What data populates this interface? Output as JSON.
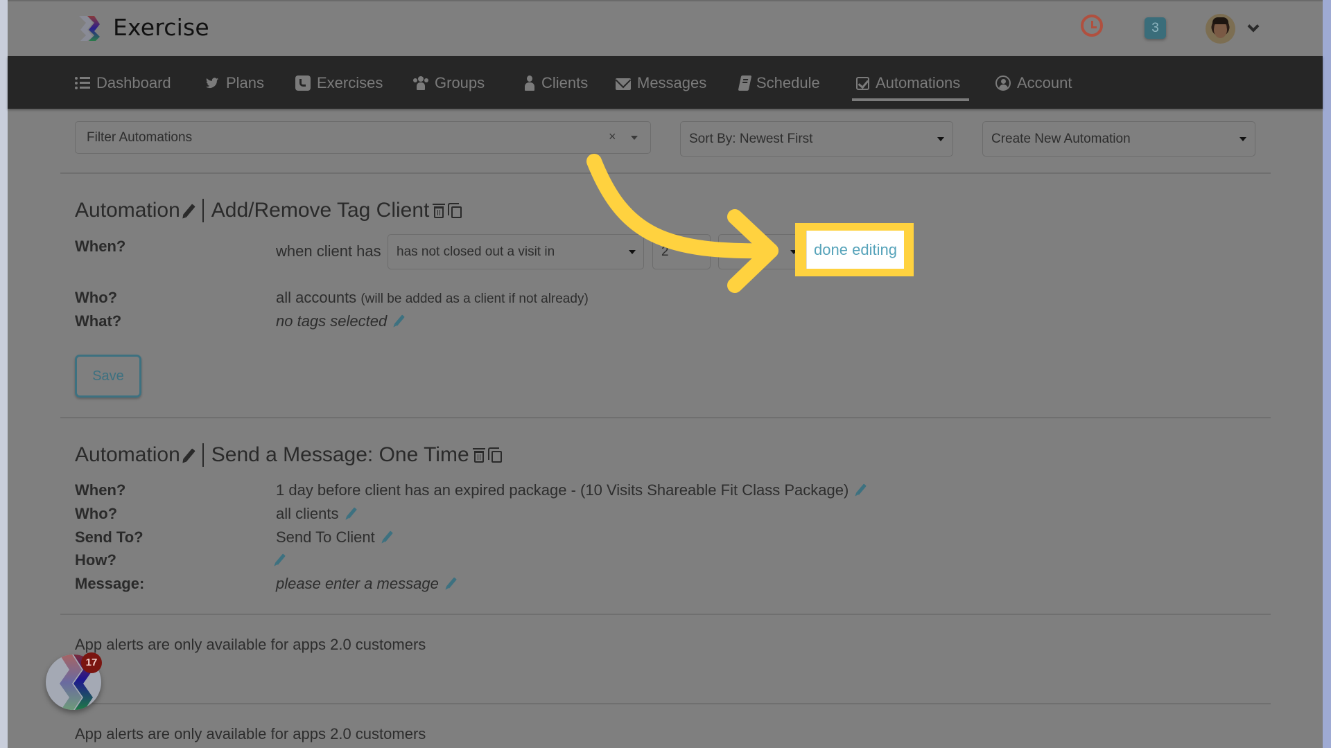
{
  "app": {
    "title": "Exercise"
  },
  "header": {
    "notification_count": "3",
    "floating_badge_count": "17"
  },
  "nav": {
    "items": [
      {
        "label": "Dashboard",
        "icon": "list-icon"
      },
      {
        "label": "Plans",
        "icon": "twitter-icon"
      },
      {
        "label": "Exercises",
        "icon": "phone-square-icon"
      },
      {
        "label": "Groups",
        "icon": "users-icon"
      },
      {
        "label": "Clients",
        "icon": "user-icon"
      },
      {
        "label": "Messages",
        "icon": "envelope-icon"
      },
      {
        "label": "Schedule",
        "icon": "book-icon"
      },
      {
        "label": "Automations",
        "icon": "check-square-icon",
        "active": true
      },
      {
        "label": "Account",
        "icon": "user-circle-icon"
      }
    ]
  },
  "toolbar": {
    "filter_placeholder": "Filter Automations",
    "filter_clear": "×",
    "sort_label": "Sort By: Newest First",
    "create_label": "Create New Automation"
  },
  "automation1": {
    "heading_prefix": "Automation",
    "heading_title": "Add/Remove Tag Client",
    "when_label": "When?",
    "when_prefix": "when client has",
    "condition_select": "has not closed out a visit in",
    "count_value": "2",
    "unit_select": "",
    "done_editing": "done editing",
    "who_label": "Who?",
    "who_value": "all accounts",
    "who_note": "(will be added as a client if not already)",
    "what_label": "What?",
    "what_value": "no tags selected",
    "save_label": "Save"
  },
  "automation2": {
    "heading_prefix": "Automation",
    "heading_title": "Send a Message: One Time",
    "rows": [
      {
        "label": "When?",
        "value": "1 day before client has an expired package - (10 Visits Shareable Fit Class Package)"
      },
      {
        "label": "Who?",
        "value": "all clients"
      },
      {
        "label": "Send To?",
        "value": "Send To Client"
      },
      {
        "label": "How?",
        "value": ""
      },
      {
        "label": "Message:",
        "value": "please enter a message"
      }
    ]
  },
  "alerts": [
    "App alerts are only available for apps 2.0 customers",
    "App alerts are only available for apps 2.0 customers"
  ],
  "colors": {
    "highlight": "#ffd23f",
    "accent_teal": "#3d7180",
    "link": "#56a3ba",
    "clock_red": "#b0503f"
  }
}
